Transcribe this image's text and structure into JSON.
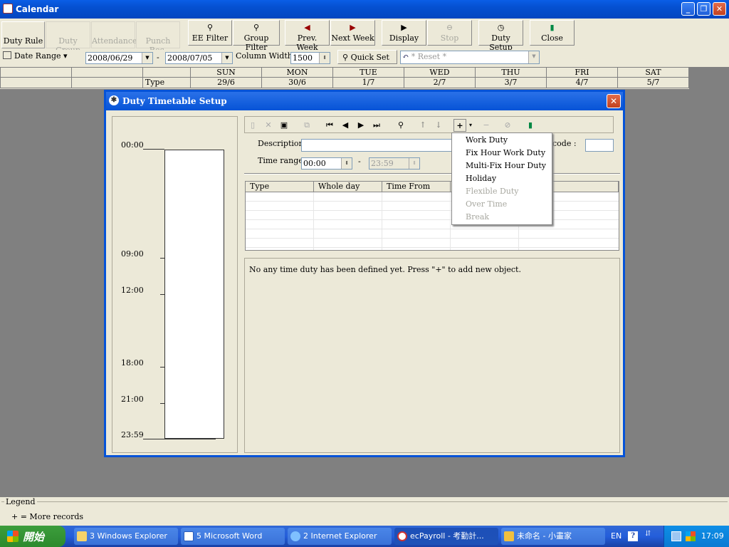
{
  "window": {
    "title": "Calendar"
  },
  "tabs": [
    {
      "label": "Duty Rule",
      "state": "active"
    },
    {
      "label": "Duty Group",
      "state": "disabled"
    },
    {
      "label": "Attendance",
      "state": "disabled"
    },
    {
      "label": "Punch Rec.",
      "state": "disabled"
    }
  ],
  "toolbar": {
    "ee_filter": "EE Filter",
    "group_filter": "Group Filter",
    "prev_week": "Prev. Week",
    "next_week": "Next Week",
    "display": "Display",
    "stop": "Stop",
    "duty_setup": "Duty Setup",
    "close": "Close"
  },
  "filters": {
    "date_range_label": "Date Range",
    "date_from": "2008/06/29",
    "date_sep": "-",
    "date_to": "2008/07/05",
    "column_width_label": "Column Width",
    "column_width": "1500",
    "quick_set_label": "Quick Set",
    "reset_placeholder": "* Reset *"
  },
  "calendar": {
    "row_label": "Type",
    "days": [
      {
        "name": "SUN",
        "date": "29/6"
      },
      {
        "name": "MON",
        "date": "30/6"
      },
      {
        "name": "TUE",
        "date": "1/7"
      },
      {
        "name": "WED",
        "date": "2/7"
      },
      {
        "name": "THU",
        "date": "3/7"
      },
      {
        "name": "FRI",
        "date": "4/7"
      },
      {
        "name": "SAT",
        "date": "5/7"
      }
    ]
  },
  "dialog": {
    "title": "Duty Timetable Setup",
    "timeline": [
      "00:00",
      "09:00",
      "12:00",
      "18:00",
      "21:00",
      "23:59"
    ],
    "description_label": "Description",
    "description_value": "",
    "count_code_label": "nt code :",
    "time_range_label": "Time range",
    "time_from": "00:00",
    "time_sep": "-",
    "time_to": "23:59",
    "columns": [
      "Type",
      "Whole day",
      "Time From",
      "",
      ""
    ],
    "empty_message": "No any time duty has been defined yet. Press \"+\" to add new object.",
    "add_menu": [
      {
        "label": "Work Duty",
        "enabled": true
      },
      {
        "label": "Fix Hour Work Duty",
        "enabled": true
      },
      {
        "label": "Multi-Fix Hour Duty",
        "enabled": true
      },
      {
        "label": "Holiday",
        "enabled": true
      },
      {
        "label": "Flexible Duty",
        "enabled": false
      },
      {
        "label": "Over Time",
        "enabled": false
      },
      {
        "label": "Break",
        "enabled": false
      }
    ]
  },
  "legend": {
    "title": "Legend",
    "text": "+ = More records"
  },
  "taskbar": {
    "start_label": "開始",
    "tasks": [
      {
        "label": "3 Windows Explorer",
        "icon": "folder-icon"
      },
      {
        "label": "5 Microsoft Word",
        "icon": "word-icon"
      },
      {
        "label": "2 Internet Explorer",
        "icon": "ie-icon"
      },
      {
        "label": "ecPayroll - 考勤計...",
        "icon": "app-icon"
      },
      {
        "label": "未命名 - 小畫家",
        "icon": "paint-icon"
      }
    ],
    "lang": "EN",
    "clock": "17:09"
  }
}
